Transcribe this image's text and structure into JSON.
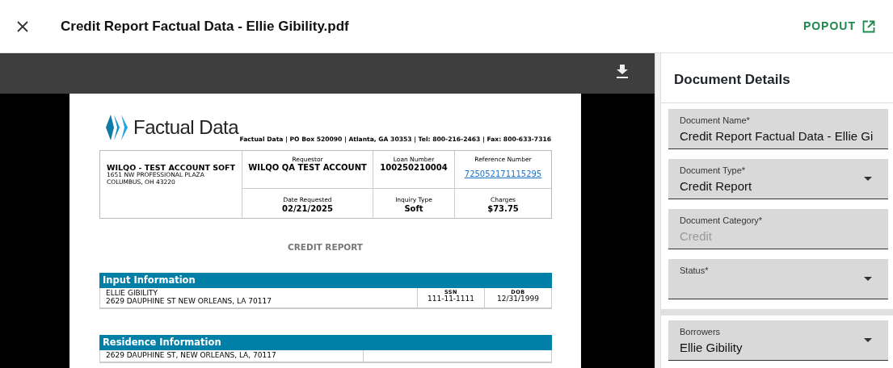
{
  "header": {
    "title": "Credit Report Factual Data - Ellie Gibility.pdf",
    "popout": "POPOUT"
  },
  "viewer": {
    "document": {
      "logo_text": "Factual Data",
      "contact": "Factual Data | PO Box 520090 | Atlanta, GA 30353 | Tel: 800-216-2463 | Fax: 800-633-7316",
      "account": {
        "name": "WILQO - TEST ACCOUNT SOFT",
        "address_lines": [
          "1651 NW PROFESSIONAL PLAZA",
          "COLUMBUS, OH 43220"
        ]
      },
      "info_cells": [
        {
          "label": "Requestor",
          "value": "WILQO QA TEST ACCOUNT",
          "kind": "text"
        },
        {
          "label": "Loan Number",
          "value": "100250210004",
          "kind": "text"
        },
        {
          "label": "Reference Number",
          "value": "725052171115295",
          "kind": "link"
        },
        {
          "label": "Date Requested",
          "value": "02/21/2025",
          "kind": "text"
        },
        {
          "label": "Inquiry Type",
          "value": "Soft",
          "kind": "text"
        },
        {
          "label": "Charges",
          "value": "$73.75",
          "kind": "text"
        }
      ],
      "report_title": "CREDIT REPORT",
      "input_section": {
        "title": "Input Information",
        "name": "ELLIE GIBILITY",
        "address": "2629 DAUPHINE ST NEW ORLEANS, LA 70117",
        "ssn_label": "SSN",
        "ssn": "111-11-1111",
        "dob_label": "DOB",
        "dob": "12/31/1999"
      },
      "residence_section": {
        "title": "Residence Information",
        "address": "2629 DAUPHINE ST, NEW ORLEANS, LA, 70117"
      }
    }
  },
  "panel": {
    "title": "Document Details",
    "fields": [
      {
        "label": "Document Name*",
        "value": "Credit Report Factual Data - Ellie Gi",
        "kind": "text",
        "disabled": false
      },
      {
        "label": "Document Type*",
        "value": "Credit Report",
        "kind": "select",
        "disabled": false
      },
      {
        "label": "Document Category*",
        "value": "Credit",
        "kind": "text",
        "disabled": true
      },
      {
        "label": "Status*",
        "kind": "select",
        "disabled": false
      }
    ],
    "borrowers": {
      "label": "Borrowers",
      "value": "Ellie Gibility",
      "kind": "select"
    }
  }
}
